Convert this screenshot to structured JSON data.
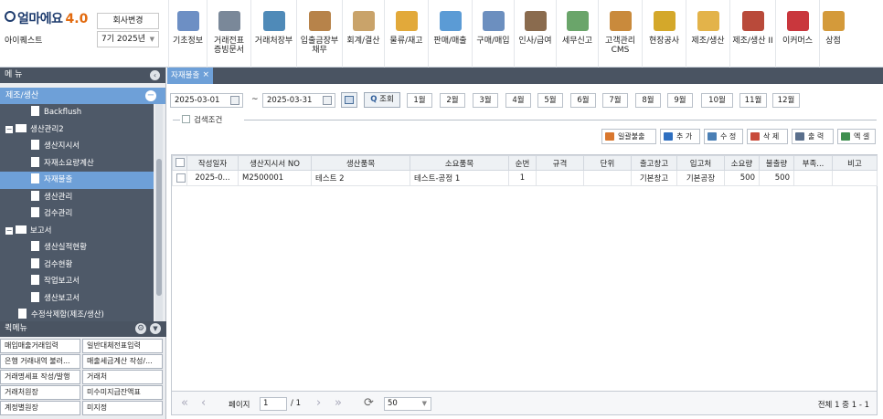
{
  "app": {
    "logo_text": "얼마에요",
    "version": "4.0",
    "company_name": "아이퀘스트",
    "change_company_button": "회사변경",
    "fiscal_year": "7기 2025년"
  },
  "top_menu": [
    {
      "label": "기초정보",
      "icon": "basic-info-icon",
      "color": "#6d8fc4"
    },
    {
      "label": "거래전표\n증빙문서",
      "icon": "voucher-icon",
      "color": "#7a8899"
    },
    {
      "label": "거래처장부",
      "icon": "ledger-icon",
      "color": "#4f8ab8"
    },
    {
      "label": "입출금장부\n채무",
      "icon": "cash-ledger-icon",
      "color": "#b7834a"
    },
    {
      "label": "회계/결산",
      "icon": "accounting-icon",
      "color": "#c9a36a"
    },
    {
      "label": "물류/재고",
      "icon": "logistics-icon",
      "color": "#e2a93a"
    },
    {
      "label": "판매/매출",
      "icon": "sales-icon",
      "color": "#5b9bd5"
    },
    {
      "label": "구매/매입",
      "icon": "purchase-icon",
      "color": "#6c8fbf"
    },
    {
      "label": "인사/급여",
      "icon": "hr-icon",
      "color": "#8a6b4e"
    },
    {
      "label": "세무신고",
      "icon": "tax-icon",
      "color": "#6aa56a"
    },
    {
      "label": "고객관리\nCMS",
      "icon": "customer-icon",
      "color": "#c98a3c"
    },
    {
      "label": "현장공사",
      "icon": "construction-icon",
      "color": "#d4a82a"
    },
    {
      "label": "제조/생산",
      "icon": "manufacturing-icon",
      "color": "#e3b34a"
    },
    {
      "label": "제조/생산 II",
      "icon": "manufacturing2-icon",
      "color": "#b94a3a"
    },
    {
      "label": "이커머스",
      "icon": "ecommerce-icon",
      "color": "#c9373d"
    },
    {
      "label": "상점",
      "icon": "store-icon",
      "color": "#d49a3a"
    }
  ],
  "sidebar": {
    "header": "메 뉴",
    "category": "제조/생산",
    "tree": [
      {
        "label": "Backflush",
        "type": "doc",
        "indent": 2,
        "selected": false
      },
      {
        "label": "생산관리2",
        "type": "folder",
        "indent": 0,
        "selected": false
      },
      {
        "label": "생산지시서",
        "type": "doc",
        "indent": 2,
        "selected": false
      },
      {
        "label": "자재소요량계산",
        "type": "doc",
        "indent": 2,
        "selected": false
      },
      {
        "label": "자재불출",
        "type": "doc",
        "indent": 2,
        "selected": true
      },
      {
        "label": "생산관리",
        "type": "doc",
        "indent": 2,
        "selected": false
      },
      {
        "label": "검수관리",
        "type": "doc",
        "indent": 2,
        "selected": false
      },
      {
        "label": "보고서",
        "type": "folder",
        "indent": 0,
        "selected": false
      },
      {
        "label": "생산실적현황",
        "type": "doc",
        "indent": 2,
        "selected": false
      },
      {
        "label": "검수현황",
        "type": "doc",
        "indent": 2,
        "selected": false
      },
      {
        "label": "작업보고서",
        "type": "doc",
        "indent": 2,
        "selected": false
      },
      {
        "label": "생산보고서",
        "type": "doc",
        "indent": 2,
        "selected": false
      },
      {
        "label": "수정삭제함(제조/생산)",
        "type": "doc",
        "indent": 1,
        "selected": false
      }
    ],
    "quick_menu_header": "퀵메뉴",
    "quick_menu": [
      [
        "매입매출거래입력",
        "일반대체전표입력"
      ],
      [
        "은행 거래내역 불러...",
        "매출세금계산 작성/..."
      ],
      [
        "거래명세표 작성/발행",
        "거래처"
      ],
      [
        "거래처원장",
        "미수미지급잔액표"
      ],
      [
        "계정별원장",
        "미지정"
      ]
    ]
  },
  "tab": {
    "label": "자재불출"
  },
  "filters": {
    "date_from": "2025-03-01",
    "tilde": "~",
    "date_to": "2025-03-31",
    "search_button": "조회",
    "months": [
      "1월",
      "2월",
      "3월",
      "4월",
      "5월",
      "6월",
      "7월",
      "8월",
      "9월",
      "10월",
      "11월",
      "12월"
    ],
    "search_conditions": "검색조건"
  },
  "actions": [
    {
      "label": "일괄불출",
      "icon": "bulk-issue-icon",
      "color": "#d9772e"
    },
    {
      "label": "추 가",
      "icon": "add-icon",
      "color": "#2f6fc0"
    },
    {
      "label": "수 정",
      "icon": "edit-icon",
      "color": "#4a7fb5"
    },
    {
      "label": "삭 제",
      "icon": "delete-icon",
      "color": "#c84a3a"
    },
    {
      "label": "출 력",
      "icon": "print-icon",
      "color": "#5a6f8c"
    },
    {
      "label": "엑 셀",
      "icon": "excel-icon",
      "color": "#3f8f4f"
    }
  ],
  "table": {
    "columns": [
      "",
      "작성일자",
      "생산지시서 NO",
      "생산품목",
      "소요품목",
      "순번",
      "규격",
      "단위",
      "출고창고",
      "입고처",
      "소요량",
      "불출량",
      "부족...",
      "비고"
    ],
    "rows": [
      [
        "",
        "2025-0...",
        "M2500001",
        "테스트 2",
        "테스트-공정 1",
        "1",
        "",
        "",
        "기본창고",
        "기본공장",
        "500",
        "500",
        "",
        ""
      ]
    ]
  },
  "pager": {
    "page_label": "페이지",
    "page": "1",
    "total_pages": "/ 1",
    "page_size": "50",
    "summary": "전체 1 중 1 - 1"
  }
}
